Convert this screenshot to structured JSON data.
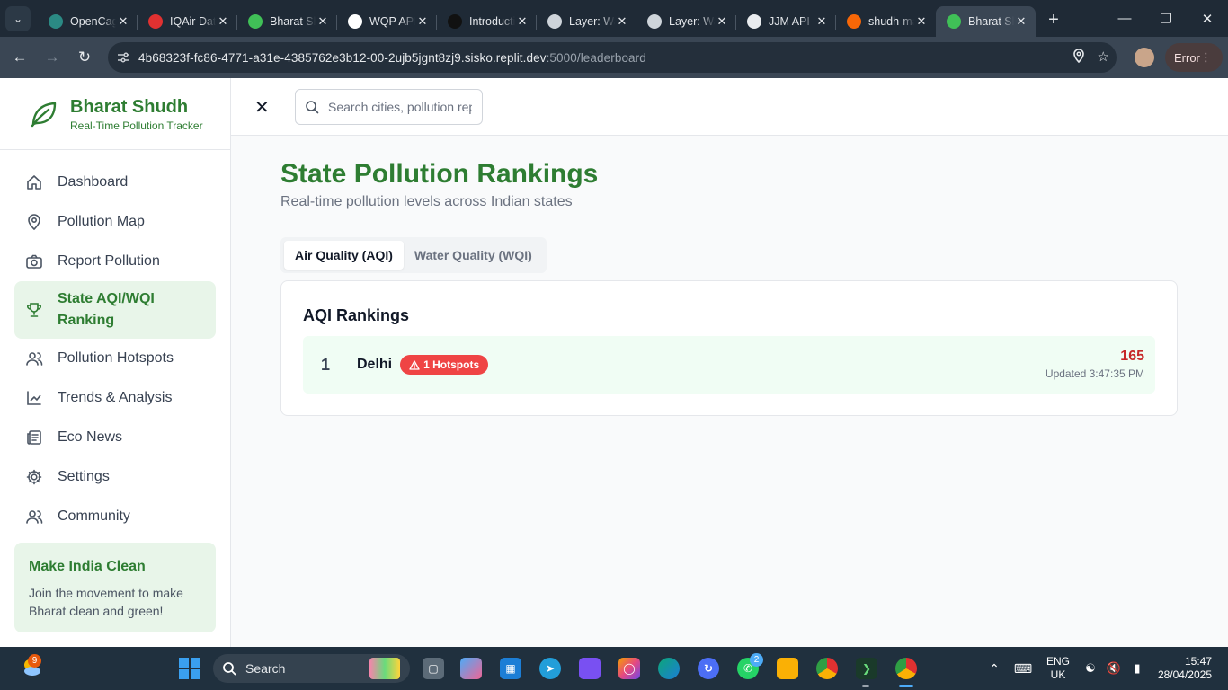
{
  "browser": {
    "tabs": [
      {
        "title": "OpenCage",
        "favicon_color": "#2b8a84",
        "active": false
      },
      {
        "title": "IQAir Data",
        "favicon_color": "#e03131",
        "active": false
      },
      {
        "title": "Bharat Shudh",
        "favicon_color": "#40c057",
        "active": false
      },
      {
        "title": "WQP API",
        "favicon_color": "#ffffff",
        "active": false
      },
      {
        "title": "Introduction",
        "favicon_color": "#111111",
        "active": false
      },
      {
        "title": "Layer: Water",
        "favicon_color": "#ced4da",
        "active": false
      },
      {
        "title": "Layer: Water",
        "favicon_color": "#ced4da",
        "active": false
      },
      {
        "title": "JJM API",
        "favicon_color": "#e9ecef",
        "active": false
      },
      {
        "title": "shudh-main",
        "favicon_color": "#f76707",
        "active": false
      },
      {
        "title": "Bharat Shudh",
        "favicon_color": "#40c057",
        "active": true
      }
    ],
    "url_host": "4b68323f-fc86-4771-a31e-4385762e3b12-00-2ujb5jgnt8zj9.sisko.replit.dev",
    "url_path": ":5000/leaderboard",
    "error_label": "Error"
  },
  "app": {
    "brand_name": "Bharat Shudh",
    "brand_tagline": "Real-Time Pollution Tracker",
    "nav": [
      {
        "label": "Dashboard",
        "icon": "home-icon",
        "active": false
      },
      {
        "label": "Pollution Map",
        "icon": "map-pin-icon",
        "active": false
      },
      {
        "label": "Report Pollution",
        "icon": "camera-icon",
        "active": false
      },
      {
        "label": "State AQI/WQI Ranking",
        "icon": "trophy-icon",
        "active": true
      },
      {
        "label": "Pollution Hotspots",
        "icon": "users-icon",
        "active": false
      },
      {
        "label": "Trends & Analysis",
        "icon": "chart-line-icon",
        "active": false
      },
      {
        "label": "Eco News",
        "icon": "newspaper-icon",
        "active": false
      },
      {
        "label": "Settings",
        "icon": "gear-icon",
        "active": false
      },
      {
        "label": "Community",
        "icon": "user-icon",
        "active": false
      }
    ],
    "promo": {
      "title": "Make India Clean",
      "text": "Join the movement to make Bharat clean and green!"
    },
    "search_placeholder": "Search cities, pollution reports..."
  },
  "page": {
    "title": "State Pollution Rankings",
    "subtitle": "Real-time pollution levels across Indian states",
    "tabs": [
      {
        "label": "Air Quality (AQI)",
        "active": true
      },
      {
        "label": "Water Quality (WQI)",
        "active": false
      }
    ],
    "card_title": "AQI Rankings",
    "rankings": [
      {
        "rank": "1",
        "state": "Delhi",
        "hotspots": "1 Hotspots",
        "value": "165",
        "updated": "Updated 3:47:35 PM"
      }
    ]
  },
  "taskbar": {
    "weather_badge": "9",
    "search_label": "Search",
    "whatsapp_badge": "2",
    "lang_line1": "ENG",
    "lang_line2": "UK",
    "time": "15:47",
    "date": "28/04/2025"
  }
}
